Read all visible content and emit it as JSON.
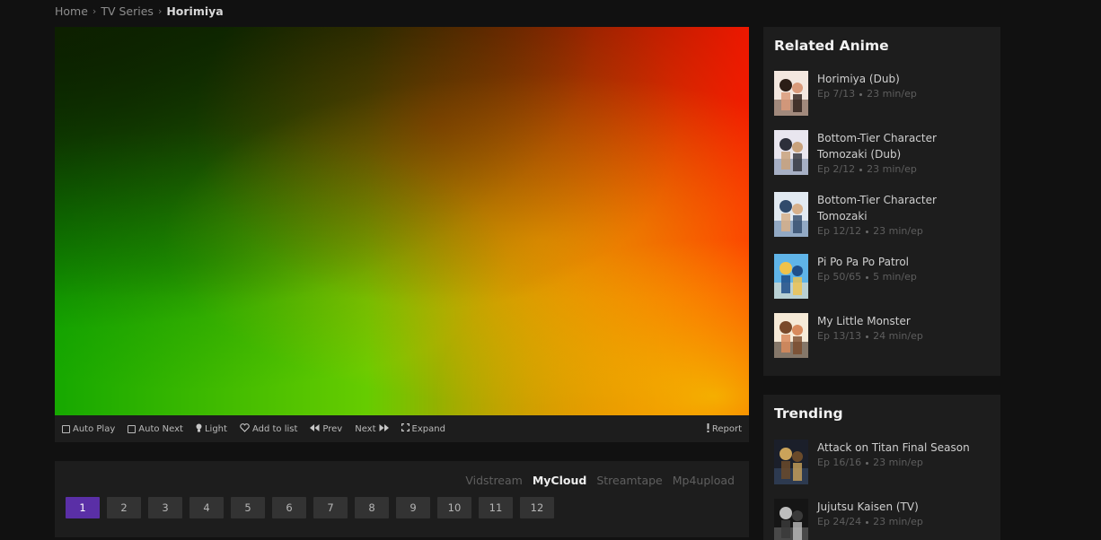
{
  "breadcrumb": {
    "home": "Home",
    "section": "TV Series",
    "current": "Horimiya",
    "separator": "›"
  },
  "player": {
    "controls": {
      "auto_play": "Auto Play",
      "auto_next": "Auto Next",
      "light": "Light",
      "add_to_list": "Add to list",
      "prev": "Prev",
      "next": "Next",
      "expand": "Expand",
      "report": "Report"
    }
  },
  "servers": [
    "Vidstream",
    "MyCloud",
    "Streamtape",
    "Mp4upload"
  ],
  "active_server": "MyCloud",
  "episodes": [
    "1",
    "2",
    "3",
    "4",
    "5",
    "6",
    "7",
    "8",
    "9",
    "10",
    "11",
    "12"
  ],
  "active_episode": "1",
  "related": {
    "title": "Related Anime",
    "items": [
      {
        "title": "Horimiya (Dub)",
        "ep": "Ep 7/13",
        "duration": "23 min/ep"
      },
      {
        "title": "Bottom-Tier Character Tomozaki (Dub)",
        "ep": "Ep 2/12",
        "duration": "23 min/ep"
      },
      {
        "title": "Bottom-Tier Character Tomozaki",
        "ep": "Ep 12/12",
        "duration": "23 min/ep"
      },
      {
        "title": "Pi Po Pa Po Patrol",
        "ep": "Ep 50/65",
        "duration": "5 min/ep"
      },
      {
        "title": "My Little Monster",
        "ep": "Ep 13/13",
        "duration": "24 min/ep"
      }
    ]
  },
  "trending": {
    "title": "Trending",
    "items": [
      {
        "title": "Attack on Titan Final Season",
        "ep": "Ep 16/16",
        "duration": "23 min/ep"
      },
      {
        "title": "Jujutsu Kaisen (TV)",
        "ep": "Ep 24/24",
        "duration": "23 min/ep"
      }
    ]
  },
  "colors": {
    "accent": "#5a2fa6",
    "panel": "#1d1d1d",
    "background": "#111111"
  }
}
